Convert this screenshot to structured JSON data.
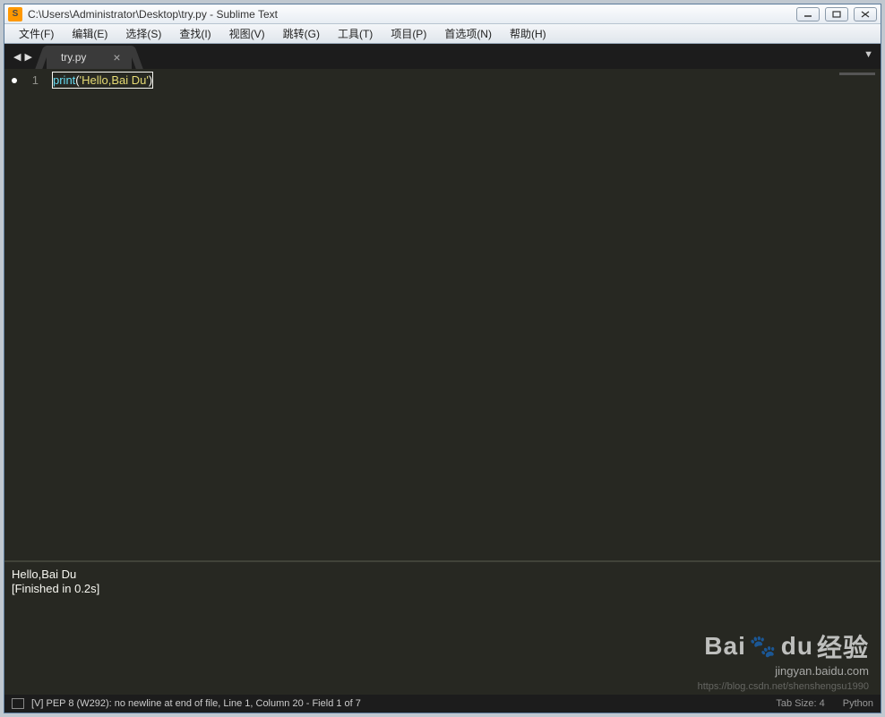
{
  "window": {
    "title": "C:\\Users\\Administrator\\Desktop\\try.py - Sublime Text"
  },
  "menu": {
    "file": "文件(F)",
    "edit": "编辑(E)",
    "select": "选择(S)",
    "find": "查找(I)",
    "view": "视图(V)",
    "goto": "跳转(G)",
    "tools": "工具(T)",
    "project": "项目(P)",
    "prefs": "首选项(N)",
    "help": "帮助(H)"
  },
  "tab": {
    "name": "try.py",
    "close": "×"
  },
  "code": {
    "line1_num": "1",
    "fn": "print",
    "open": "(",
    "str": "'Hello,Bai Du'",
    "close": ")"
  },
  "console": {
    "line1": "Hello,Bai Du",
    "line2": "[Finished in 0.2s]"
  },
  "status": {
    "left": "[V] PEP 8 (W292): no newline at end of file, Line 1, Column 20 - Field 1 of 7",
    "tabsize": "Tab Size: 4",
    "lang": "Python"
  },
  "watermark": {
    "logo_main": "Bai",
    "logo_du": "du",
    "logo_cn": "经验",
    "sub": "jingyan.baidu.com",
    "url": "https://blog.csdn.net/shenshengsu1990"
  }
}
